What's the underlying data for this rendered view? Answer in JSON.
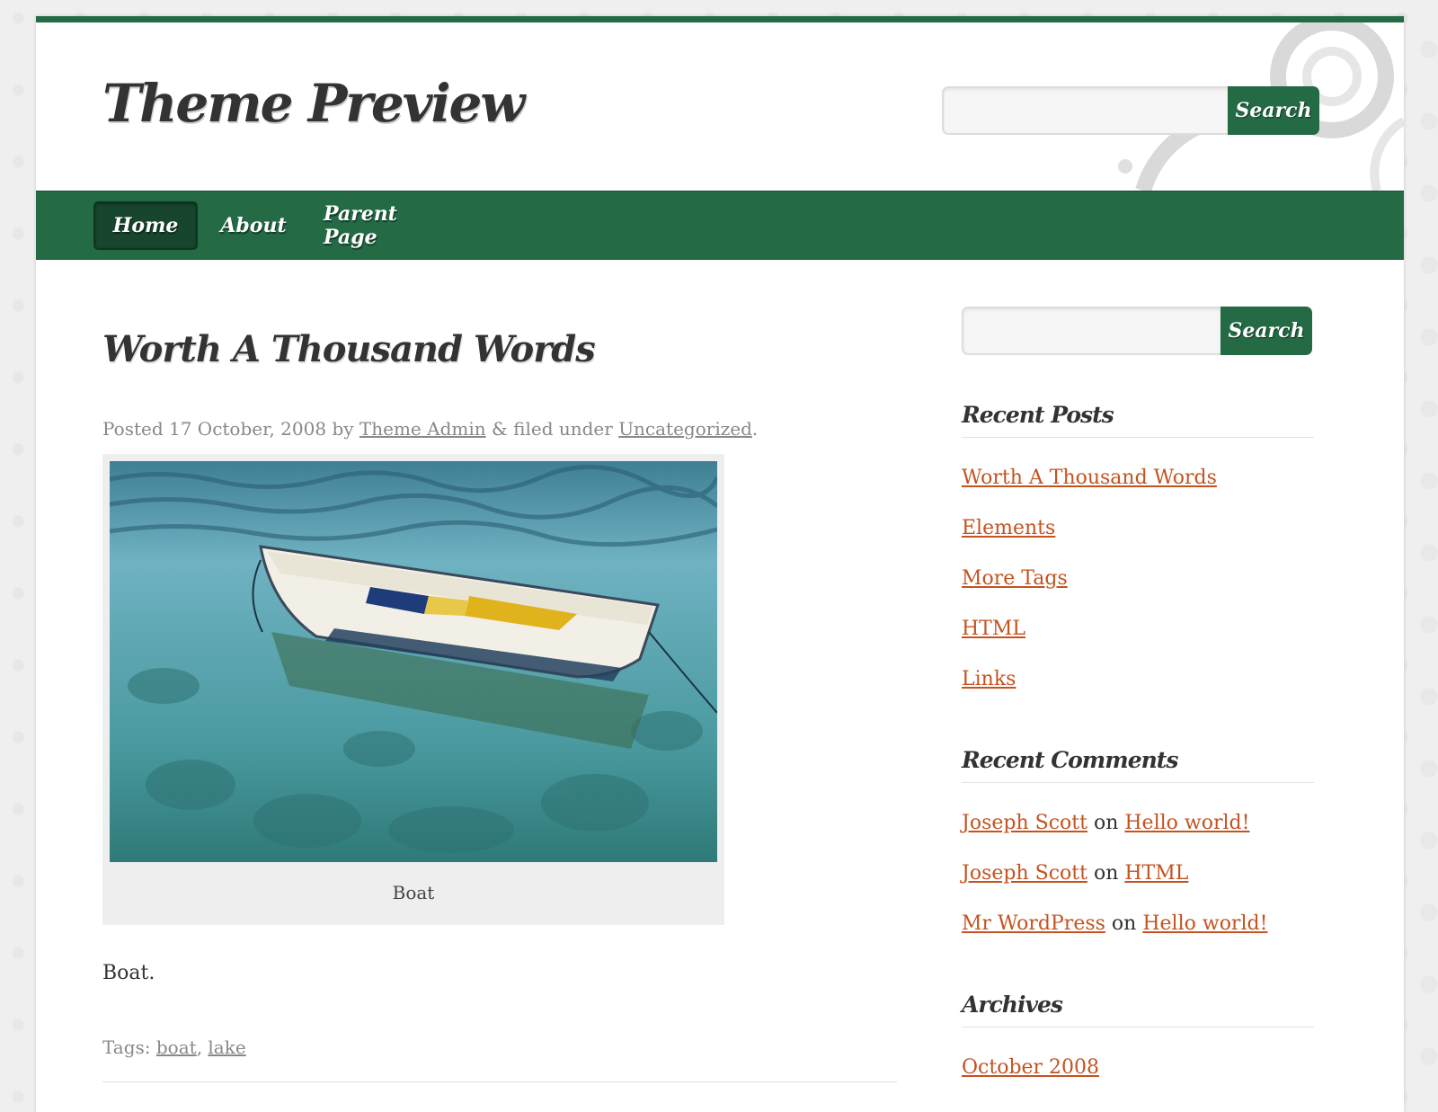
{
  "site": {
    "title": "Theme Preview"
  },
  "header_search": {
    "button": "Search",
    "placeholder": ""
  },
  "nav": {
    "items": [
      {
        "label": "Home"
      },
      {
        "label": "About"
      },
      {
        "label": "Parent Page"
      }
    ]
  },
  "post": {
    "title": "Worth A Thousand Words",
    "meta_prefix": "Posted 17 October, 2008 by",
    "author": "Theme Admin",
    "meta_mid": "& filed under",
    "category": "Uncategorized",
    "meta_suffix": ".",
    "image_caption": "Boat",
    "body": "Boat.",
    "tags_label": "Tags:",
    "tags": [
      "boat",
      "lake"
    ],
    "tags_sep": ","
  },
  "sidebar": {
    "search": {
      "button": "Search",
      "placeholder": ""
    },
    "recent_posts": {
      "title": "Recent Posts",
      "items": [
        "Worth A Thousand Words",
        "Elements",
        "More Tags",
        "HTML",
        "Links"
      ]
    },
    "recent_comments": {
      "title": "Recent Comments",
      "on_word": "on",
      "items": [
        {
          "author": "Joseph Scott",
          "post": "Hello world!"
        },
        {
          "author": "Joseph Scott",
          "post": "HTML"
        },
        {
          "author": "Mr WordPress",
          "post": "Hello world!"
        }
      ]
    },
    "archives": {
      "title": "Archives",
      "items": [
        "October 2008"
      ]
    }
  },
  "colors": {
    "brand_green": "#236a45",
    "link": "#c4531f",
    "muted": "#888888"
  }
}
